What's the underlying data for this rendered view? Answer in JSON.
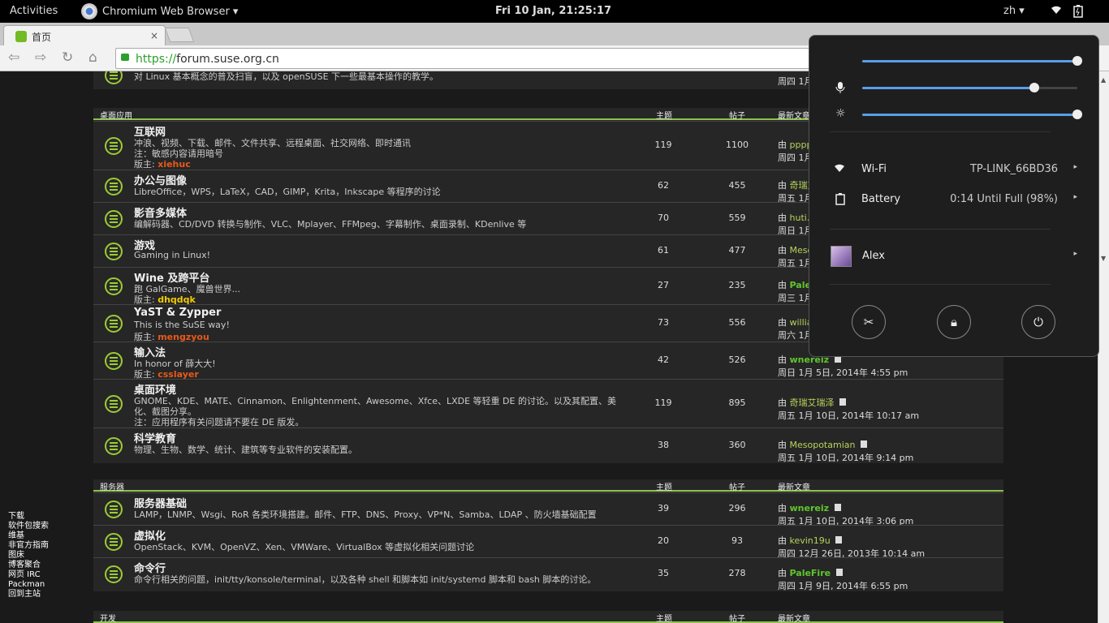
{
  "topbar": {
    "activities": "Activities",
    "app": "Chromium Web Browser ▾",
    "clock": "Fri 10 Jan, 21:25:17",
    "lang": "zh ▾"
  },
  "browser": {
    "tab_title": "首页",
    "tab_close": "×",
    "url_scheme": "https://",
    "url_rest": "forum.suse.org.cn"
  },
  "partial_row": {
    "desc": "对 Linux 基本概念的普及扫盲，以及 openSUSE 下一些最基本操作的教学。",
    "date": "周四 1月 9日, 2014年 6:17 pm"
  },
  "section_desktop": {
    "title": "桌面应用",
    "col_topics": "主题",
    "col_posts": "帖子",
    "col_last": "最新文章"
  },
  "section_server": {
    "title": "服务器",
    "col_topics": "主题",
    "col_posts": "帖子",
    "col_last": "最新文章"
  },
  "section_dev": {
    "title": "开发",
    "col_topics": "主题",
    "col_posts": "帖子",
    "col_last": "最新文章"
  },
  "by": "由",
  "mod_label": "版主:",
  "forums": [
    {
      "title": "互联网",
      "desc": "冲浪、视频、下载、邮件、文件共享、远程桌面、社交网络、即时通讯",
      "note": "注：敏感内容请用暗号",
      "mod": "xiehuc",
      "topics": "119",
      "posts": "1100",
      "user": "pppp...",
      "date": "周四 1月 9日, 2014年 10:23 am"
    },
    {
      "title": "办公与图像",
      "desc": "LibreOffice，WPS，LaTeX，CAD，GIMP，Krita，Inkscape 等程序的讨论",
      "topics": "62",
      "posts": "455",
      "user": "奇瑞艾瑞泽",
      "date": "周五 1月 10日, 2014年 10:16 am"
    },
    {
      "title": "影音多媒体",
      "desc": "编解码器、CD/DVD 转换与制作、VLC、Mplayer、FFMpeg、字幕制作、桌面录制、KDenlive 等",
      "topics": "70",
      "posts": "559",
      "user": "huti...",
      "date": "周日 1月 5日, 2014年 1:33 am"
    },
    {
      "title": "游戏",
      "desc": "Gaming in Linux!",
      "topics": "61",
      "posts": "477",
      "user": "Meso...",
      "date": "周五 1月 10日, 2014年 9:37 pm"
    },
    {
      "title": "Wine 及跨平台",
      "desc": "跑 GalGame、魔兽世界...",
      "mod": "dhqdqk",
      "topics": "27",
      "posts": "235",
      "user": "PaleFire",
      "date": "周三 1月 8日, 2014年 2:45 pm"
    },
    {
      "title": "YaST & Zypper",
      "desc": "This is the SuSE way!",
      "mod": "mengzyou",
      "topics": "73",
      "posts": "556",
      "user": "williamherry",
      "date": "周六 1月 4日, 2014年 ...00 am"
    },
    {
      "title": "输入法",
      "desc": "In honor of 薛大大!",
      "mod": "csslayer",
      "topics": "42",
      "posts": "526",
      "user": "wnereiz",
      "date": "周日 1月 5日, 2014年 4:55 pm"
    },
    {
      "title": "桌面环境",
      "desc": "GNOME、KDE、MATE、Cinnamon、Enlightenment、Awesome、Xfce、LXDE 等轻重 DE 的讨论。以及其配置、美",
      "desc2": "化、截图分享。",
      "note": "注：应用程序有关问题请不要在 DE 版发。",
      "topics": "119",
      "posts": "895",
      "user": "奇瑞艾瑞泽",
      "date": "周五 1月 10日, 2014年 10:17 am"
    },
    {
      "title": "科学教育",
      "desc": "物理、生物、数学、统计、建筑等专业软件的安装配置。",
      "topics": "38",
      "posts": "360",
      "user": "Mesopotamian",
      "date": "周五 1月 10日, 2014年 9:14 pm"
    },
    {
      "title": "服务器基础",
      "desc": "LAMP，LNMP、Wsgi、RoR 各类环境搭建。邮件、FTP、DNS、Proxy、VP*N、Samba、LDAP 、防火墙基础配置",
      "topics": "39",
      "posts": "296",
      "user": "wnereiz",
      "date": "周五 1月 10日, 2014年 3:06 pm"
    },
    {
      "title": "虚拟化",
      "desc": "OpenStack、KVM、OpenVZ、Xen、VMWare、VirtualBox 等虚拟化相关问题讨论",
      "topics": "20",
      "posts": "93",
      "user": "kevin19u",
      "date": "周四 12月 26日, 2013年 10:14 am"
    },
    {
      "title": "命令行",
      "desc": "命令行相关的问题，init/tty/konsole/terminal，以及各种 shell 和脚本如 init/systemd 脚本和 bash 脚本的讨论。",
      "topics": "35",
      "posts": "278",
      "user": "PaleFire",
      "date": "周四 1月 9日, 2014年 6:55 pm"
    }
  ],
  "sidebar": [
    "下载",
    "软件包搜索",
    "维基",
    "非官方指南",
    "图床",
    "博客聚合",
    "网页 IRC",
    "Packman",
    "回到主站"
  ],
  "panel": {
    "volume": 1.0,
    "mic": 0.8,
    "brightness": 1.0,
    "wifi_label": "Wi-Fi",
    "wifi_value": "TP-LINK_66BD36",
    "battery_label": "Battery",
    "battery_value": "0:14 Until Full (98%)",
    "user": "Alex",
    "arrow": "▸"
  }
}
